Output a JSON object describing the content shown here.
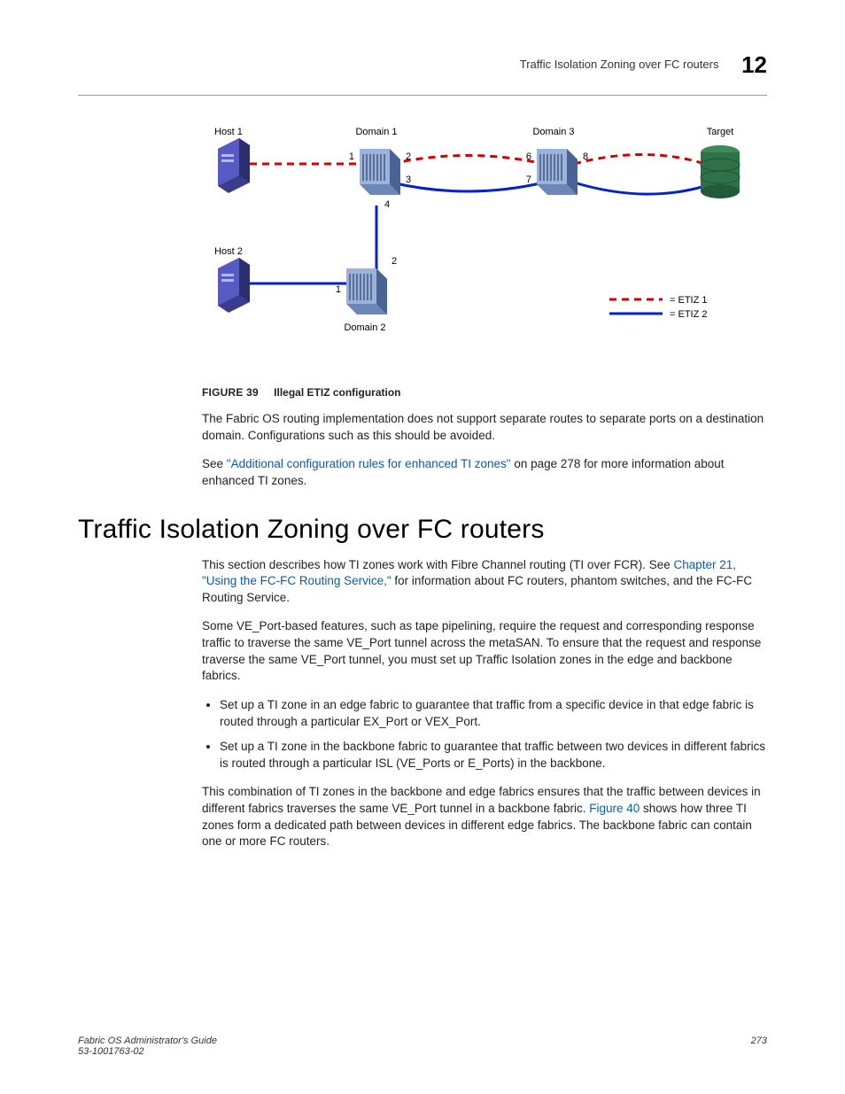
{
  "header": {
    "title": "Traffic Isolation Zoning over FC routers",
    "chapter_number": "12"
  },
  "figure": {
    "number": "FIGURE 39",
    "title": "Illegal ETIZ configuration",
    "labels": {
      "host1": "Host 1",
      "host2": "Host 2",
      "domain1": "Domain 1",
      "domain2": "Domain 2",
      "domain3": "Domain 3",
      "target": "Target",
      "p1": "1",
      "p2": "2",
      "p3": "3",
      "p4": "4",
      "p6": "6",
      "p7": "7",
      "p8": "8",
      "sw2p1": "1",
      "sw2p2": "2",
      "legend1": "= ETIZ 1",
      "legend2": "= ETIZ 2"
    }
  },
  "para1": "The Fabric OS routing implementation does not support separate routes to separate ports on a destination domain. Configurations such as this should be avoided.",
  "para2_a": "See ",
  "para2_link": "\"Additional configuration rules for enhanced TI zones\"",
  "para2_b": " on page 278 for more information about enhanced TI zones.",
  "section_heading": "Traffic Isolation Zoning over FC routers",
  "para3_a": "This section describes how TI zones work with Fibre Channel routing (TI over FCR). See ",
  "para3_link": "Chapter 21, \"Using the FC-FC Routing Service,\"",
  "para3_b": " for information about FC routers, phantom switches, and the FC-FC Routing Service.",
  "para4": "Some VE_Port-based features, such as tape pipelining, require the request and corresponding response traffic to traverse the same VE_Port tunnel across the metaSAN. To ensure that the request and response traverse the same VE_Port tunnel, you must set up Traffic Isolation zones in the edge and backbone fabrics.",
  "bullets": [
    "Set up a TI zone in an edge fabric to guarantee that traffic from a specific device in that edge fabric is routed through a particular EX_Port or VEX_Port.",
    "Set up a TI zone in the backbone fabric to guarantee that traffic between two devices in different fabrics is routed through a particular ISL (VE_Ports or E_Ports) in the backbone."
  ],
  "para5_a": "This combination of TI zones in the backbone and edge fabrics ensures that the traffic between devices in different fabrics traverses the same VE_Port tunnel in a backbone fabric. ",
  "para5_link": "Figure 40",
  "para5_b": " shows how three TI zones form a dedicated path between devices in different edge fabrics. The backbone fabric can contain one or more FC routers.",
  "footer": {
    "guide": "Fabric OS Administrator's Guide",
    "docnum": "53-1001763-02",
    "page": "273"
  }
}
